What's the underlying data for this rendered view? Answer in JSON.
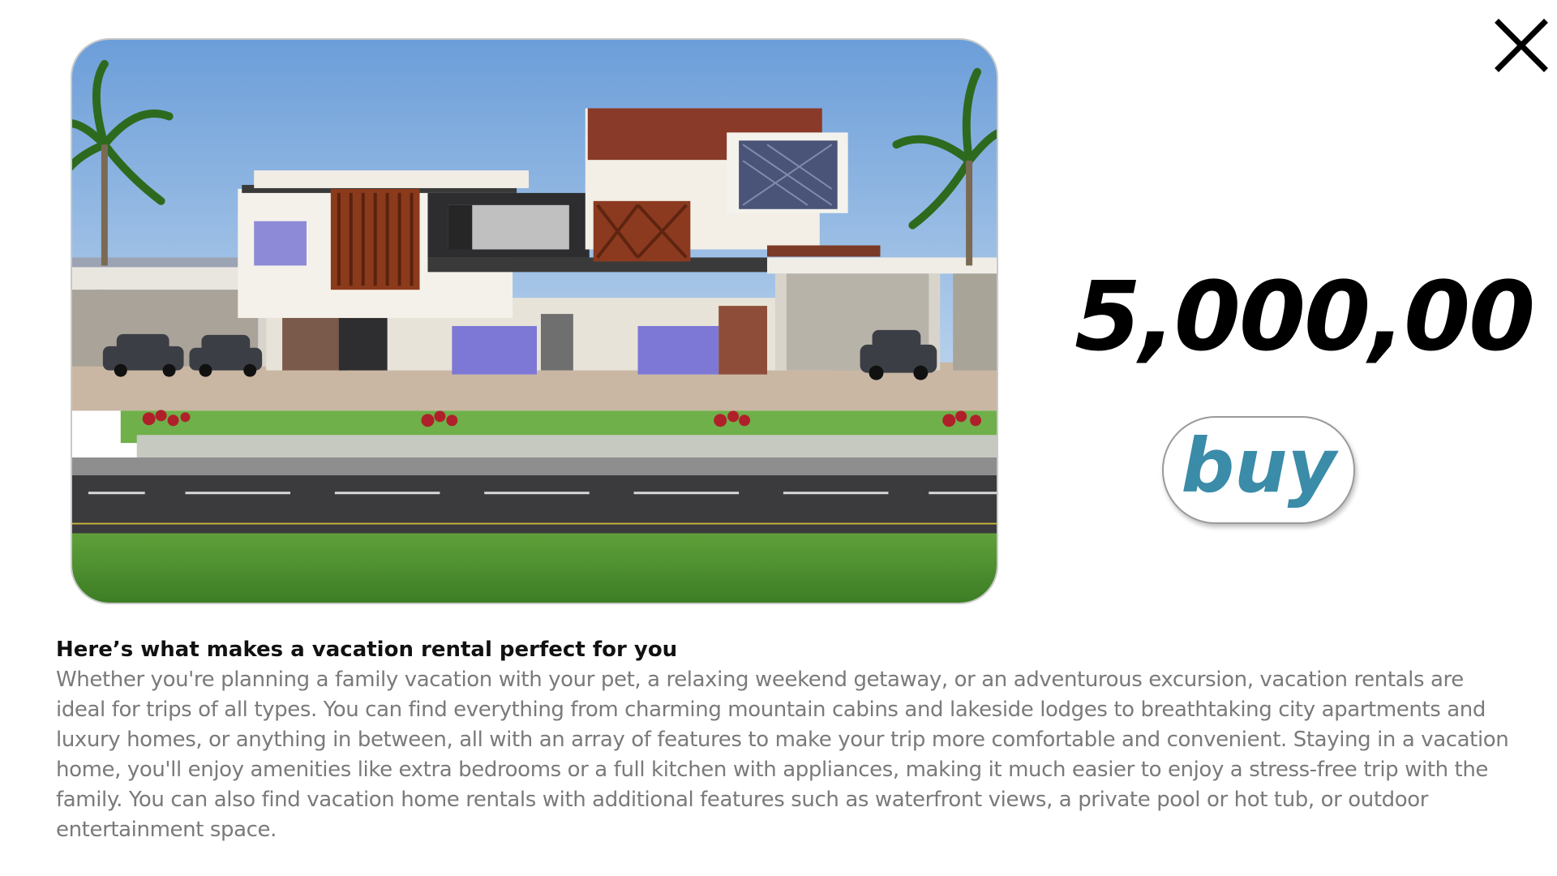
{
  "window": {
    "close_icon": "close-icon"
  },
  "listing": {
    "image_alt": "Modern two-storey villa with palm trees, parked cars, lawn and road",
    "price": "5,000,00",
    "buy_label": "buy"
  },
  "description": {
    "title": "Here’s what makes a vacation rental perfect for you",
    "body": "Whether you're planning a family vacation with your pet, a relaxing weekend getaway, or an adventurous excursion, vacation rentals are ideal for trips of all types. You can find everything from charming mountain cabins and lakeside lodges to breathtaking city apartments and luxury homes, or anything in between, all with an array of features to make your trip more comfortable and convenient. Staying in a vacation home, you'll enjoy amenities like extra bedrooms or a full kitchen with appliances, making it much easier to enjoy a stress-free trip with the family. You can also find vacation home rentals with additional features such as waterfront views, a private pool or hot tub, or outdoor entertainment space."
  },
  "colors": {
    "price": "#000000",
    "buy_text": "#3a8ca8",
    "body_text": "#7a7a7a",
    "title_text": "#111111"
  }
}
